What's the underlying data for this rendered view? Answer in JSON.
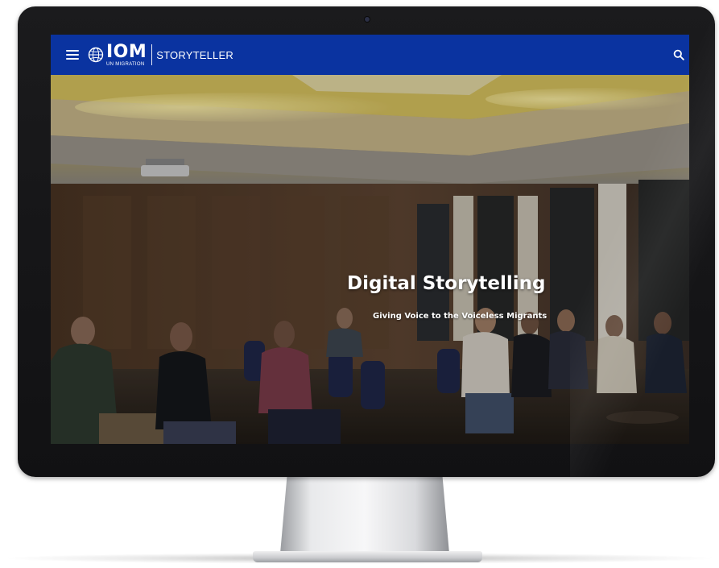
{
  "navbar": {
    "logo_main": "IOM",
    "logo_sub": "UN MIGRATION",
    "product_name": "STORYTELLER",
    "menu_icon": "hamburger-menu-icon",
    "search_icon": "search-icon",
    "background_color": "#0a33a0"
  },
  "hero": {
    "title": "Digital Storytelling",
    "subtitle": "Giving Voice to the Voiceless Migrants"
  }
}
